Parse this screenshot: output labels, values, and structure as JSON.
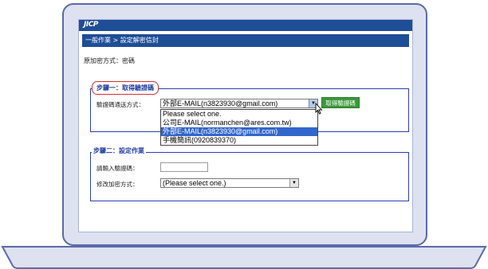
{
  "header": {
    "logo": "JICP",
    "breadcrumb": "一般作業 > 設定解密信封"
  },
  "original_encryption": "原加密方式：密碼",
  "step1": {
    "legend": "步驟一：取得驗證碼",
    "method_label": "驗證碼通送方式：",
    "selected_value": "外部E-MAIL(n3823930@gmail.com)",
    "button_label": "取得驗證碼",
    "options": [
      "Please select one.",
      "公司E-MAIL(normanchen@ares.com.tw)",
      "外部E-MAIL(n3823930@gmail.com)",
      "手機簡訊(0920839370)"
    ],
    "highlighted_index": 2
  },
  "step2": {
    "legend": "步驟二：設定作業",
    "code_label": "請輸入驗證碼：",
    "change_label": "修改加密方式：",
    "change_value": "(Please select one.)"
  }
}
